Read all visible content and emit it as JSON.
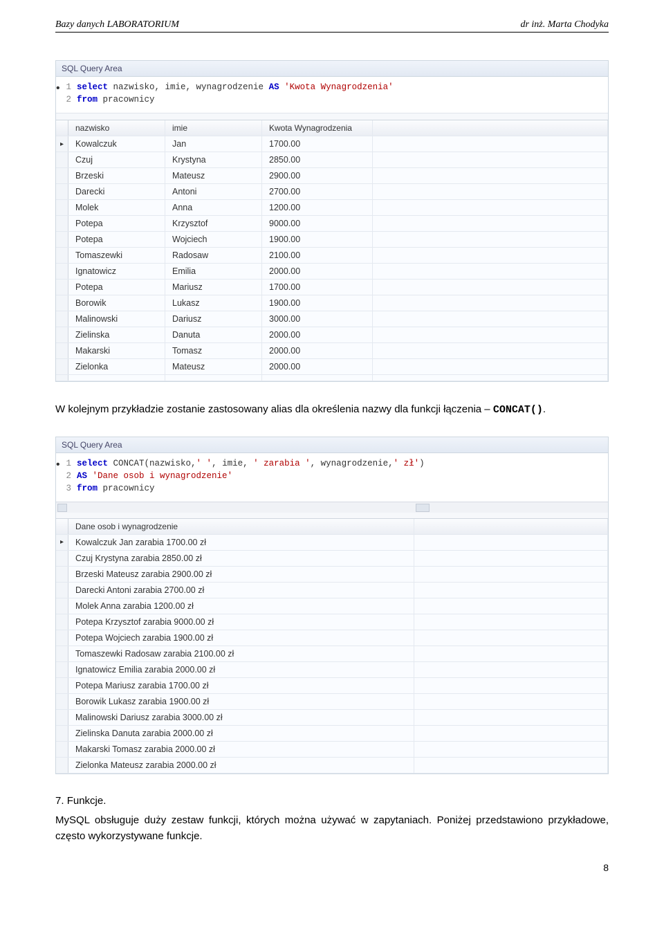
{
  "header": {
    "left": "Bazy danych LABORATORIUM",
    "right": "dr inż. Marta Chodyka"
  },
  "shot1": {
    "label": "SQL Query Area",
    "code": [
      {
        "n": "1",
        "segs": [
          [
            "kw",
            "select"
          ],
          [
            "",
            " nazwisko, imie, wynagrodzenie "
          ],
          [
            "kw",
            "AS"
          ],
          [
            "",
            " "
          ],
          [
            "str",
            "'Kwota Wynagrodzenia'"
          ]
        ]
      },
      {
        "n": "2",
        "segs": [
          [
            "kw",
            "from"
          ],
          [
            "",
            " pracownicy"
          ]
        ]
      }
    ],
    "cols": [
      "nazwisko",
      "imie",
      "Kwota Wynagrodzenia"
    ],
    "rows": [
      [
        "Kowalczuk",
        "Jan",
        "1700.00"
      ],
      [
        "Czuj",
        "Krystyna",
        "2850.00"
      ],
      [
        "Brzeski",
        "Mateusz",
        "2900.00"
      ],
      [
        "Darecki",
        "Antoni",
        "2700.00"
      ],
      [
        "Molek",
        "Anna",
        "1200.00"
      ],
      [
        "Potepa",
        "Krzysztof",
        "9000.00"
      ],
      [
        "Potepa",
        "Wojciech",
        "1900.00"
      ],
      [
        "Tomaszewki",
        "Radosaw",
        "2100.00"
      ],
      [
        "Ignatowicz",
        "Emilia",
        "2000.00"
      ],
      [
        "Potepa",
        "Mariusz",
        "1700.00"
      ],
      [
        "Borowik",
        "Lukasz",
        "1900.00"
      ],
      [
        "Malinowski",
        "Dariusz",
        "3000.00"
      ],
      [
        "Zielinska",
        "Danuta",
        "2000.00"
      ],
      [
        "Makarski",
        "Tomasz",
        "2000.00"
      ],
      [
        "Zielonka",
        "Mateusz",
        "2000.00"
      ]
    ]
  },
  "para1_a": "W kolejnym przykładzie zostanie zastosowany alias dla określenia nazwy dla funkcji łączenia – ",
  "para1_b": "CONCAT()",
  "para1_c": ".",
  "shot2": {
    "label": "SQL Query Area",
    "code": [
      {
        "n": "1",
        "segs": [
          [
            "kw",
            "select"
          ],
          [
            "",
            " CONCAT(nazwisko,"
          ],
          [
            "str",
            "' '"
          ],
          [
            "",
            ", imie, "
          ],
          [
            "str",
            "' zarabia '"
          ],
          [
            "",
            ", wynagrodzenie,"
          ],
          [
            "str",
            "' zł'"
          ],
          [
            "",
            ")"
          ]
        ]
      },
      {
        "n": "2",
        "segs": [
          [
            "kw",
            "AS"
          ],
          [
            "",
            " "
          ],
          [
            "str",
            "'Dane osob i wynagrodzenie'"
          ]
        ]
      },
      {
        "n": "3",
        "segs": [
          [
            "kw",
            "from"
          ],
          [
            "",
            " pracownicy"
          ]
        ]
      }
    ],
    "col": "Dane osob i wynagrodzenie",
    "rows": [
      "Kowalczuk Jan zarabia 1700.00 zł",
      "Czuj Krystyna zarabia 2850.00 zł",
      "Brzeski Mateusz zarabia 2900.00 zł",
      "Darecki Antoni zarabia 2700.00 zł",
      "Molek Anna zarabia 1200.00 zł",
      "Potepa Krzysztof zarabia 9000.00 zł",
      "Potepa Wojciech zarabia 1900.00 zł",
      "Tomaszewki Radosaw zarabia 2100.00 zł",
      "Ignatowicz Emilia zarabia 2000.00 zł",
      "Potepa Mariusz zarabia 1700.00 zł",
      "Borowik Lukasz zarabia 1900.00 zł",
      "Malinowski Dariusz zarabia 3000.00 zł",
      "Zielinska Danuta zarabia 2000.00 zł",
      "Makarski Tomasz zarabia 2000.00 zł",
      "Zielonka Mateusz zarabia 2000.00 zł"
    ]
  },
  "sec7": {
    "num": "7.",
    "title": "Funkcje."
  },
  "para2": "MySQL obsługuje duży zestaw funkcji, których można używać w zapytaniach. Poniżej przedstawiono przykładowe, często wykorzystywane funkcje.",
  "page": "8"
}
